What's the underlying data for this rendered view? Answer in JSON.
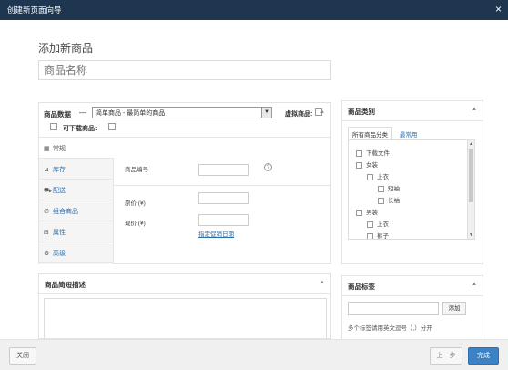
{
  "window": {
    "title": "创建新页面向导",
    "close_glyph": "×"
  },
  "page": {
    "heading": "添加新商品",
    "name_placeholder": "商品名称"
  },
  "product_data": {
    "label": "商品数据",
    "dash": "—",
    "type_selected": "简单商品 - 最简单的商品",
    "virtual_label": "虚拟商品:",
    "downloadable_label": "可下载商品:",
    "tabs": [
      {
        "label": "常规",
        "icon": "grid-icon"
      },
      {
        "label": "库存",
        "icon": "chart-icon"
      },
      {
        "label": "配送",
        "icon": "truck-icon"
      },
      {
        "label": "组合商品",
        "icon": "link-icon"
      },
      {
        "label": "属性",
        "icon": "list-icon"
      },
      {
        "label": "高级",
        "icon": "gear-icon"
      }
    ],
    "fields": {
      "sku_label": "商品编号",
      "regular_price_label": "原价 (¥)",
      "sale_price_label": "现价 (¥)",
      "schedule_link": "指定促销日期"
    }
  },
  "short_description": {
    "label": "商品简短描述"
  },
  "categories": {
    "label": "商品类别",
    "tab_all": "所有商品分类",
    "tab_popular": "最常用",
    "items": [
      {
        "label": "下载文件",
        "level": 0
      },
      {
        "label": "女装",
        "level": 0
      },
      {
        "label": "上衣",
        "level": 1
      },
      {
        "label": "短袖",
        "level": 2
      },
      {
        "label": "长袖",
        "level": 2
      },
      {
        "label": "男装",
        "level": 0
      },
      {
        "label": "上衣",
        "level": 1
      },
      {
        "label": "裤子",
        "level": 1
      }
    ]
  },
  "tags": {
    "label": "商品标签",
    "add_button": "添加",
    "hint": "多个标签请用英文逗号（,）分开"
  },
  "footer": {
    "close": "关闭",
    "prev": "上一步",
    "finish": "完成"
  }
}
